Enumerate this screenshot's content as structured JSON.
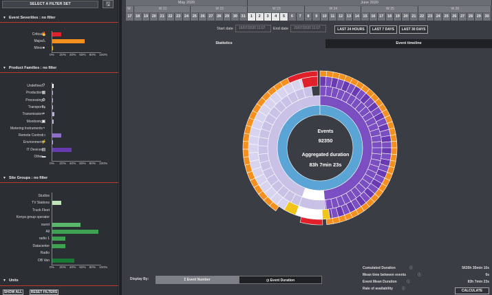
{
  "left_panel": {
    "filter_set_label": "SELECT A FILTER SET",
    "save_icon": "save-icon",
    "severities": {
      "title": "Event Severities : no filter",
      "items": [
        {
          "label": "Critical",
          "icon": "flame-icon",
          "value": 0.2,
          "color": "#e0202a"
        },
        {
          "label": "Major",
          "icon": "warning-icon",
          "value": 0.67,
          "color": "#f5901e"
        },
        {
          "label": "Minor",
          "icon": "circle-icon",
          "value": 0.03,
          "color": "#f2c318"
        }
      ]
    },
    "families": {
      "title": "Product Families : no filter",
      "items": [
        {
          "label": "Undefined",
          "icon": "question-icon",
          "value": 0.04,
          "color": "#ffffff"
        },
        {
          "label": "Production",
          "icon": "grid-icon",
          "value": 0.02,
          "color": "#b8b0d6"
        },
        {
          "label": "Processing",
          "icon": "settings-icon",
          "value": 0.03,
          "color": "#b8b0d6"
        },
        {
          "label": "Transport",
          "icon": "transport-icon",
          "value": 0.03,
          "color": "#b8b0d6"
        },
        {
          "label": "Transmission",
          "icon": "antenna-icon",
          "value": 0.05,
          "color": "#b8b0d6"
        },
        {
          "label": "Monitoring",
          "icon": "monitor-icon",
          "value": 0.04,
          "color": "#b8b0d6"
        },
        {
          "label": "Metering Instruments",
          "icon": "gauge-icon",
          "value": 0.0,
          "color": "#b8b0d6"
        },
        {
          "label": "Remote Control",
          "icon": "remote-icon",
          "value": 0.2,
          "color": "#8e6fc6"
        },
        {
          "label": "Environment",
          "icon": "plug-icon",
          "value": 0.03,
          "color": "#b8b0d6"
        },
        {
          "label": "IT Devices",
          "icon": "server-icon",
          "value": 0.4,
          "color": "#6a3ab3"
        },
        {
          "label": "Other",
          "icon": "other-icon",
          "value": 0.0,
          "color": "#b8b0d6"
        }
      ]
    },
    "sites": {
      "title": "Site Groups : no filter",
      "items": [
        {
          "label": "Studios",
          "value": 0.0,
          "color": "#bfe5b8"
        },
        {
          "label": "TV Stations",
          "value": 0.19,
          "color": "#bfe5b8"
        },
        {
          "label": "Truck Fleet",
          "value": 0.0,
          "color": "#bfe5b8"
        },
        {
          "label": "Kenya group operator",
          "value": 0.0,
          "color": "#bfe5b8"
        },
        {
          "label": "ouest",
          "value": 0.58,
          "color": "#58b76a"
        },
        {
          "label": "All",
          "value": 0.95,
          "color": "#3fa253"
        },
        {
          "label": "radio 1",
          "value": 0.28,
          "color": "#3fa253"
        },
        {
          "label": "Datacenter",
          "value": 0.28,
          "color": "#3fa253"
        },
        {
          "label": "Radio",
          "value": 0.0,
          "color": "#3fa253"
        },
        {
          "label": "OB Van",
          "value": 0.46,
          "color": "#197a36"
        }
      ]
    },
    "ticks": [
      "0%",
      "20%",
      "40%",
      "60%",
      "80%",
      "100%"
    ],
    "units_title": "Units",
    "show_all": "SHOW ALL",
    "reset_filters": "RESET FILTERS"
  },
  "timeline": {
    "months": [
      "May 2020",
      "June 2020"
    ],
    "weeks": [
      "W 20",
      "W 21",
      "W 22",
      "W 23",
      "W 24",
      "W 25",
      "W 26"
    ],
    "days": [
      "17",
      "18",
      "19",
      "20",
      "21",
      "22",
      "23",
      "24",
      "25",
      "26",
      "27",
      "28",
      "29",
      "30",
      "31",
      "1",
      "2",
      "3",
      "4",
      "5",
      "6",
      "7",
      "8",
      "9",
      "10",
      "11",
      "12",
      "13",
      "14",
      "15",
      "16",
      "17",
      "18",
      "19",
      "20",
      "21",
      "22",
      "23",
      "24",
      "25",
      "26",
      "27",
      "28",
      "29",
      "30"
    ]
  },
  "dates": {
    "start_label": "Start date",
    "start_value": "16/07/2020 11:07",
    "end_label": "End date",
    "end_value": "20/07/2020 11:07",
    "btn_24h": "LAST 24 HOURS",
    "btn_7d": "LAST 7 DAYS",
    "btn_30d": "LAST 30 DAYS"
  },
  "tabs": {
    "statistics": "Statistics",
    "timeline": "Event timeline"
  },
  "center": {
    "events_label": "Events",
    "events_value": "92350",
    "duration_label": "Aggregated duration",
    "duration_value": "83h 7min 23s"
  },
  "display_by": {
    "label": "Display By:",
    "event_number": "Event Number",
    "event_duration": "Event Duration"
  },
  "stats": [
    {
      "label": "Cumulated Duration",
      "value": "5635h 35min 10s"
    },
    {
      "label": "Mean time between events",
      "value": "0s"
    },
    {
      "label": "Event Mean Duration",
      "value": "83h 7min 23s"
    },
    {
      "label": "Rate of availability",
      "value": ""
    }
  ],
  "calculate": "CALCULATE"
}
